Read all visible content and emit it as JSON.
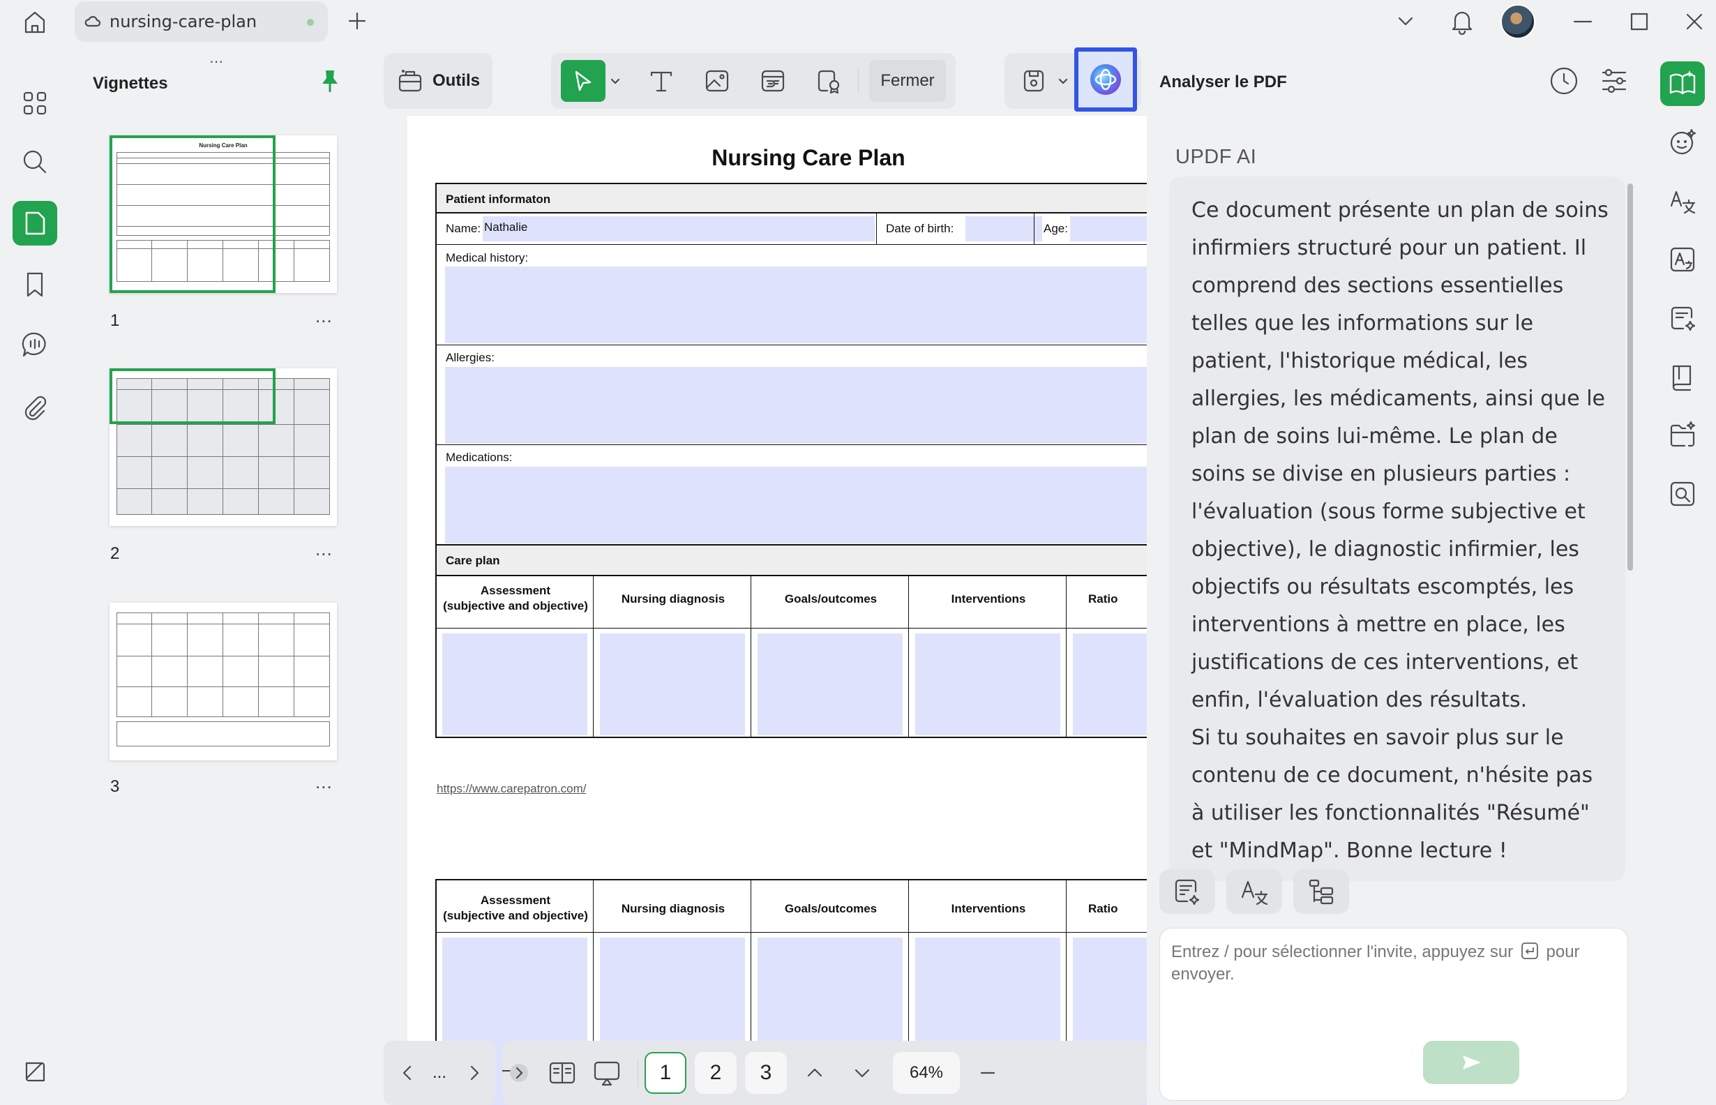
{
  "titlebar": {
    "tab_title": "nursing-care-plan"
  },
  "thumbnails": {
    "title": "Vignettes",
    "pages": [
      {
        "number": "1",
        "more": "..."
      },
      {
        "number": "2",
        "more": "..."
      },
      {
        "number": "3",
        "more": "..."
      }
    ],
    "thumb1_title": "Nursing Care Plan"
  },
  "toolbar": {
    "tools_label": "Outils",
    "close_label": "Fermer"
  },
  "document": {
    "title": "Nursing Care Plan",
    "patient_info": "Patient informaton",
    "name_label": "Name:",
    "name_value": "Nathalie",
    "dob_label": "Date of birth:",
    "age_label": "Age:",
    "medical_history": "Medical history:",
    "allergies": "Allergies:",
    "medications": "Medications:",
    "care_plan": "Care plan",
    "col_assessment_1": "Assessment",
    "col_assessment_2": "(subjective and objective)",
    "col_diagnosis": "Nursing diagnosis",
    "col_goals": "Goals/outcomes",
    "col_interventions": "Interventions",
    "col_rationale_partial": "Ratio",
    "url": "https://www.carepatron.com/"
  },
  "bottombar": {
    "dots": "...",
    "pages": [
      "1",
      "2",
      "3"
    ],
    "current_page": "1",
    "zoom": "64%"
  },
  "ai_panel": {
    "header": "Analyser le PDF",
    "label": "UPDF AI",
    "message_p1": "Ce document présente un plan de soins infirmiers structuré pour un patient. Il comprend des sections essentielles telles que les informations sur le patient, l'historique médical, les allergies, les médicaments, ainsi que le plan de soins lui-même. Le plan de soins se divise en plusieurs parties : l'évaluation (sous forme subjective et objective), le diagnostic infirmier, les objectifs ou résultats escomptés, les interventions à mettre en place, les justifications de ces interventions, et enfin, l'évaluation des résultats.",
    "message_p2": "Si tu souhaites en savoir plus sur le contenu de ce document, n'hésite pas à utiliser les fonctionnalités \"Résumé\" et \"MindMap\". Bonne lecture !",
    "input_placeholder_1": "Entrez / pour sélectionner l'invite, appuyez sur",
    "input_placeholder_2": "pour envoyer."
  },
  "colors": {
    "accent": "#22a34f",
    "form_field": "#dfe2fc",
    "highlight_border": "#3355e6"
  }
}
